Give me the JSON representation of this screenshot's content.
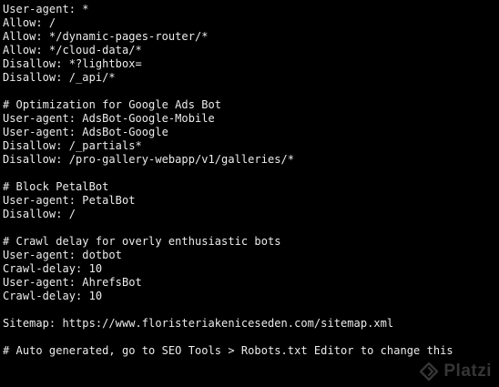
{
  "terminal": {
    "lines": [
      "User-agent: *",
      "Allow: /",
      "Allow: */dynamic-pages-router/*",
      "Allow: */cloud-data/*",
      "Disallow: *?lightbox=",
      "Disallow: /_api/*",
      "",
      "# Optimization for Google Ads Bot",
      "User-agent: AdsBot-Google-Mobile",
      "User-agent: AdsBot-Google",
      "Disallow: /_partials*",
      "Disallow: /pro-gallery-webapp/v1/galleries/*",
      "",
      "# Block PetalBot",
      "User-agent: PetalBot",
      "Disallow: /",
      "",
      "# Crawl delay for overly enthusiastic bots",
      "User-agent: dotbot",
      "Crawl-delay: 10",
      "User-agent: AhrefsBot",
      "Crawl-delay: 10",
      "",
      "Sitemap: https://www.floristeriakeniceseden.com/sitemap.xml",
      "",
      "# Auto generated, go to SEO Tools > Robots.txt Editor to change this"
    ]
  },
  "watermark": {
    "text": "Platzi",
    "icon": "platzi-logo-icon"
  },
  "colors": {
    "background": "#000000",
    "text": "#ececec",
    "watermark": "#3c3c3c"
  }
}
